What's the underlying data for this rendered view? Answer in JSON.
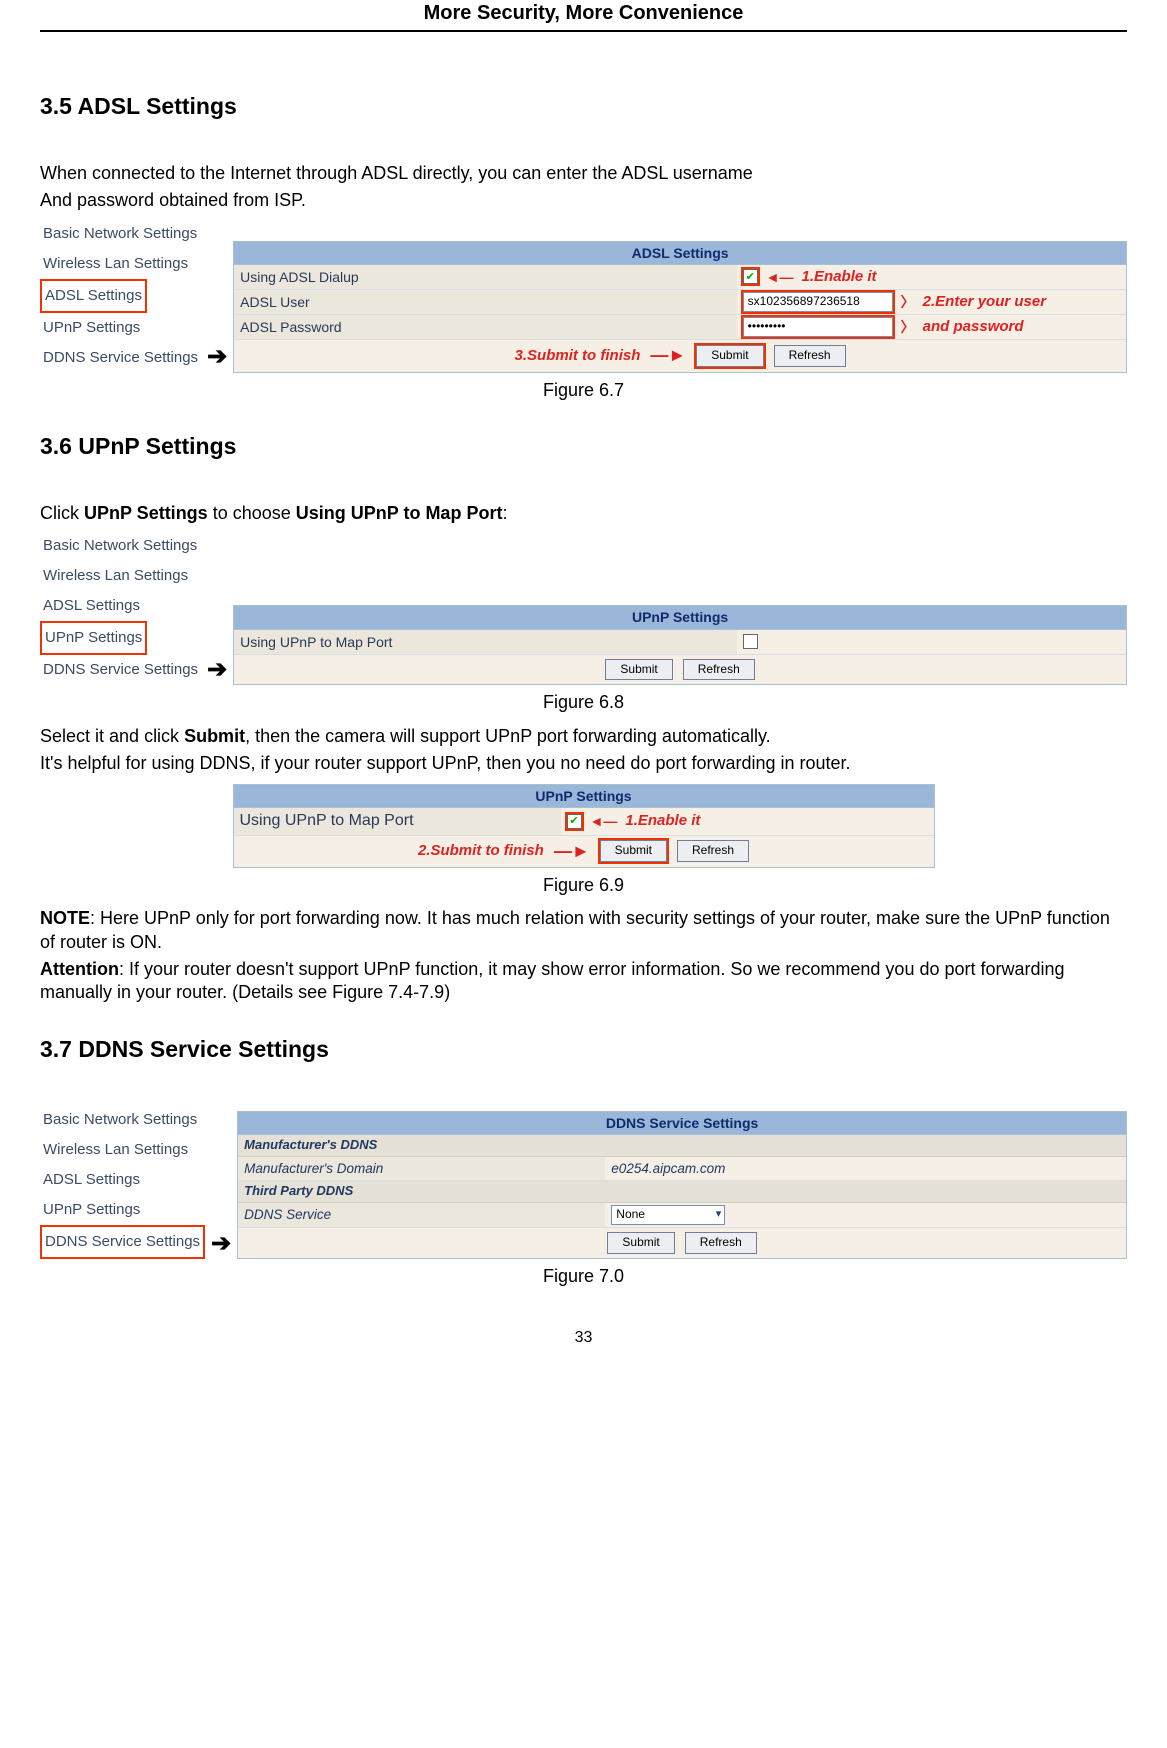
{
  "header": "More Security, More Convenience",
  "page_number": "33",
  "menu": {
    "items": [
      "Basic Network Settings",
      "Wireless Lan Settings",
      "ADSL Settings",
      "UPnP Settings",
      "DDNS Service Settings"
    ]
  },
  "s35": {
    "heading": "3.5 ADSL Settings",
    "intro1": "When connected to the Internet through ADSL directly, you can enter the ADSL username",
    "intro2": "And password obtained from ISP.",
    "panel_title": "ADSL Settings",
    "row1_label": "Using ADSL Dialup",
    "row2_label": "ADSL User",
    "row2_value": "sx102356897236518",
    "row3_label": "ADSL Password",
    "row3_value": "•••••••••",
    "annot1": "1.Enable it",
    "annot2a": "2.Enter your user",
    "annot2b": "and password",
    "annot3": "3.Submit to finish",
    "btn_submit": "Submit",
    "btn_refresh": "Refresh",
    "caption": "Figure 6.7"
  },
  "s36": {
    "heading": "3.6 UPnP Settings",
    "intro_pre": "Click ",
    "intro_b1": "UPnP Settings",
    "intro_mid": " to choose ",
    "intro_b2": "Using UPnP to Map Port",
    "intro_post": ":",
    "panel_title": "UPnP Settings",
    "row1_label": "Using UPnP to Map Port",
    "btn_submit": "Submit",
    "btn_refresh": "Refresh",
    "caption1": "Figure 6.8",
    "after1a_pre": "Select it and click ",
    "after1a_b": "Submit",
    "after1a_post": ", then the camera will support UPnP port forwarding automatically.",
    "after1b": "It's helpful for using DDNS, if your router support UPnP, then you no need do port forwarding in router.",
    "annot1": "1.Enable it",
    "annot2": "2.Submit to finish",
    "caption2": "Figure 6.9",
    "note_b": "NOTE",
    "note_rest": ": Here UPnP only for port forwarding now. It has much relation with security settings of your router, make sure the UPnP function of router is ON.",
    "attn_b": "Attention",
    "attn_rest": ": If your router doesn't support UPnP function, it may show error information. So we recommend you do port forwarding manually in your router. (Details see Figure 7.4-7.9)"
  },
  "s37": {
    "heading": "3.7 DDNS Service Settings",
    "panel_title": "DDNS Service Settings",
    "sec1": "Manufacturer's DDNS",
    "row1_label": "Manufacturer's Domain",
    "row1_value": "e0254.aipcam.com",
    "sec2": "Third Party DDNS",
    "row2_label": "DDNS Service",
    "row2_value": "None",
    "btn_submit": "Submit",
    "btn_refresh": "Refresh",
    "caption": "Figure 7.0"
  }
}
